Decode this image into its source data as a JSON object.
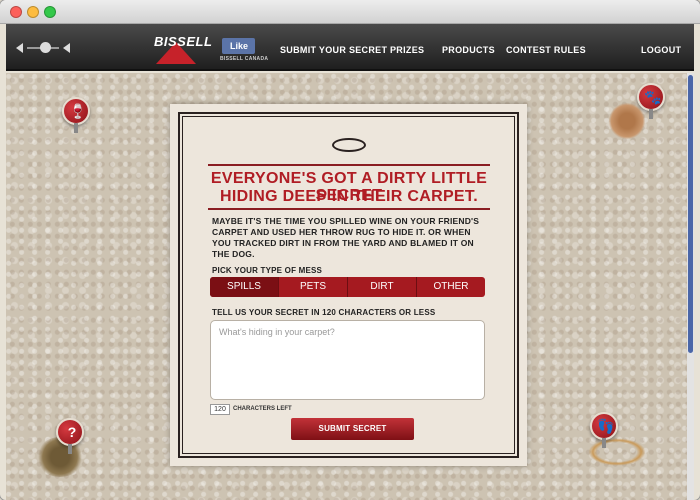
{
  "window": {
    "traffic_lights": [
      "close",
      "minimize",
      "zoom"
    ]
  },
  "nav": {
    "logo_text": "BISSELL",
    "like_label": "Like",
    "like_sub": "BISSELL CANADA",
    "links": [
      "SUBMIT YOUR SECRET",
      "PRIZES",
      "PRODUCTS",
      "CONTEST RULES"
    ],
    "logout": "LOGOUT"
  },
  "card": {
    "headline_1": "EVERYONE'S GOT A DIRTY LITTLE SECRET",
    "headline_2": "HIDING DEEP IN THEIR CARPET.",
    "body": "MAYBE IT'S THE TIME YOU SPILLED WINE ON YOUR FRIEND'S CARPET AND USED HER THROW RUG TO HIDE IT. OR WHEN YOU TRACKED DIRT IN FROM THE YARD AND BLAMED IT ON THE DOG.",
    "mess_label": "PICK YOUR TYPE OF MESS",
    "mess_types": [
      "SPILLS",
      "PETS",
      "DIRT",
      "OTHER"
    ],
    "secret_label": "TELL US YOUR SECRET IN 120 CHARACTERS OR LESS",
    "textarea_placeholder": "What's hiding in your carpet?",
    "char_count": "120",
    "char_label": "CHARACTERS LEFT",
    "submit": "SUBMIT SECRET"
  },
  "pins": [
    {
      "icon": "wine-glass-icon",
      "glyph": "🍷"
    },
    {
      "icon": "paw-icon",
      "glyph": "🐾"
    },
    {
      "icon": "question-icon",
      "glyph": "?"
    },
    {
      "icon": "footprints-icon",
      "glyph": "👣"
    }
  ],
  "colors": {
    "accent_red": "#b01d24",
    "nav_dark": "#2a2a2a",
    "card_bg": "#ede6dc"
  }
}
